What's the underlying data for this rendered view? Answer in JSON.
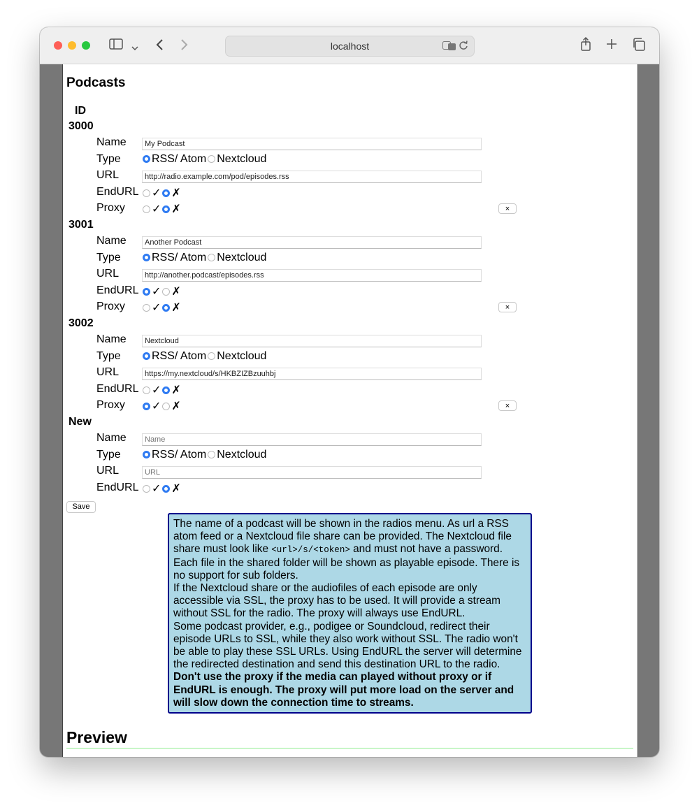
{
  "browser": {
    "url": "localhost"
  },
  "page": {
    "title": "Podcasts",
    "id_header": "ID",
    "labels": {
      "name": "Name",
      "type": "Type",
      "url": "URL",
      "endurl": "EndURL",
      "proxy": "Proxy"
    },
    "type_options": [
      "RSS/ Atom",
      "Nextcloud"
    ],
    "check_yes": "✓",
    "check_no": "✗",
    "delete_label": "×",
    "podcasts": [
      {
        "id": "3000",
        "name": "My Podcast",
        "type": "RSS/ Atom",
        "url": "http://radio.example.com/pod/episodes.rss",
        "endurl": false,
        "proxy": false
      },
      {
        "id": "3001",
        "name": "Another Podcast",
        "type": "RSS/ Atom",
        "url": "http://another.podcast/episodes.rss",
        "endurl": true,
        "proxy": false
      },
      {
        "id": "3002",
        "name": "Nextcloud",
        "type": "RSS/ Atom",
        "url": "https://my.nextcloud/s/HKBZIZBzuuhbj",
        "endurl": false,
        "proxy": true
      }
    ],
    "new_entry": {
      "id": "New",
      "name_placeholder": "Name",
      "url_placeholder": "URL",
      "type": "RSS/ Atom",
      "endurl": false
    },
    "save_label": "Save",
    "help": {
      "p1a": "The name of a podcast will be shown in the radios menu. As url a RSS atom feed or a Nextcloud file share can be provided. The Nextcloud file share must look like ",
      "code": "<url>/s/<token>",
      "p1b": " and must not have a password. Each file in the shared folder will be shown as playable episode. There is no support for sub folders.",
      "p2": "If the Nextcloud share or the audiofiles of each episode are only accessible via SSL, the proxy has to be used. It will provide a stream without SSL for the radio. The proxy will always use EndURL.",
      "p3": "Some podcast provider, e.g., podigee or Soundcloud, redirect their episode URLs to SSL, while they also work without SSL. The radio won't be able to play these SSL URLs. Using EndURL the server will determine the redirected destination and send this destination URL to the radio. ",
      "p3_bold": "Don't use the proxy if the media can played without proxy or if EndURL is enough. The proxy will put more load on the server and will slow down the connection time to streams."
    },
    "preview_title": "Preview"
  }
}
